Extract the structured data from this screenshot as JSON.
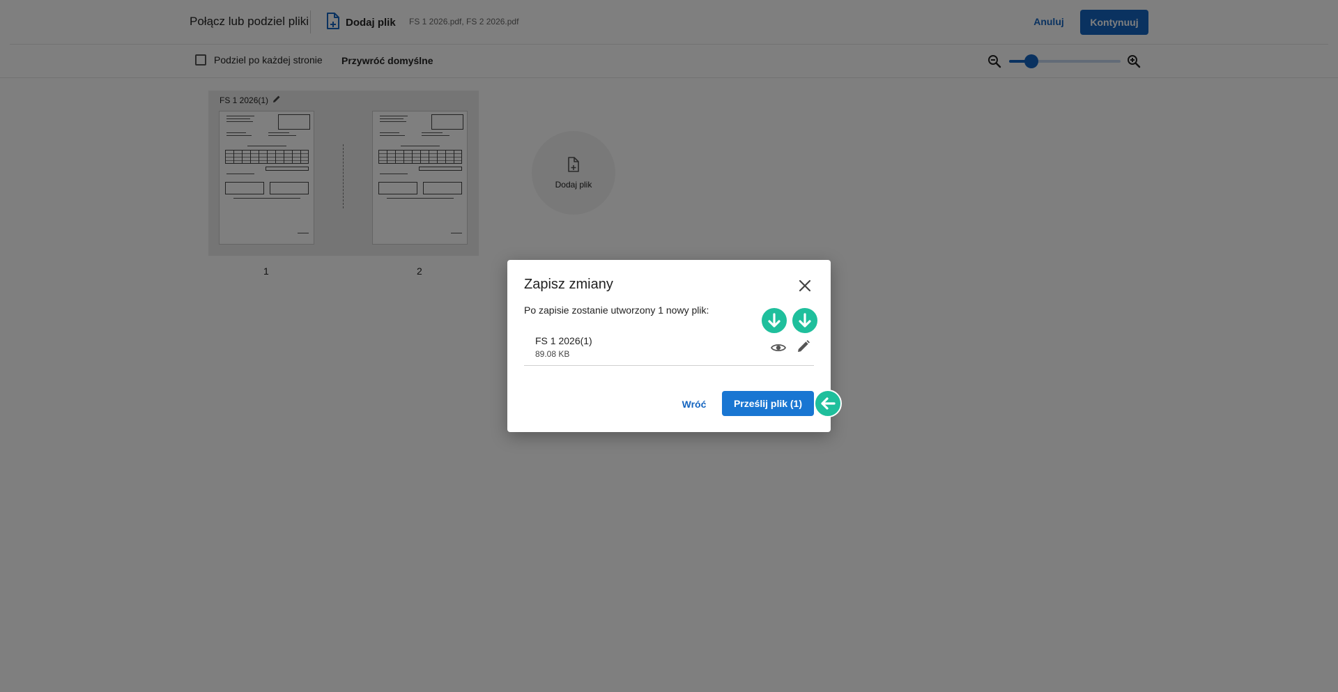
{
  "header": {
    "title": "Połącz lub podziel pliki",
    "add_file_label": "Dodaj plik",
    "files": "FS 1 2026.pdf, FS 2 2026.pdf",
    "cancel_label": "Anuluj",
    "continue_label": "Kontynuuj"
  },
  "toolbar": {
    "split_each_page_label": "Podziel po każdej stronie",
    "split_each_page_checked": false,
    "restore_defaults_label": "Przywróć domyślne",
    "zoom_level_fraction": 0.2
  },
  "document": {
    "title": "FS 1 2026(1)",
    "pages": [
      "1",
      "2"
    ],
    "add_file_label": "Dodaj plik"
  },
  "dialog": {
    "title": "Zapisz zmiany",
    "message": "Po zapisie zostanie utworzony 1 nowy plik:",
    "file": {
      "name": "FS 1 2026(1)",
      "size": "89.08 KB"
    },
    "back_label": "Wróć",
    "upload_label": "Prześlij plik (1)"
  },
  "colors": {
    "primary": "#1565c0",
    "indicator": "#1fbf9c",
    "overlay": "rgba(0,0,0,0.5)"
  },
  "icons": [
    "add-file-icon",
    "zoom-out-icon",
    "zoom-in-icon",
    "pencil-icon",
    "close-icon",
    "eye-icon",
    "edit-icon",
    "arrow-down-icon",
    "arrow-left-icon"
  ]
}
